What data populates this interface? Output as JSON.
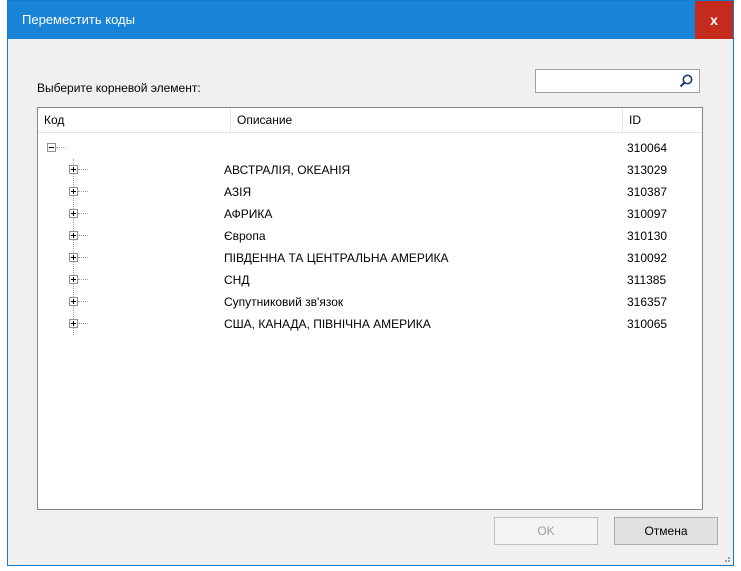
{
  "window": {
    "title": "Переместить коды",
    "close_label": "x"
  },
  "prompt_label": "Выберите корневой элемент:",
  "search": {
    "value": "",
    "placeholder": ""
  },
  "columns": {
    "code": "Код",
    "description": "Описание",
    "id": "ID"
  },
  "root": {
    "description": "",
    "id": "310064",
    "expanded": true
  },
  "rows": [
    {
      "description": "АВСТРАЛІЯ, ОКЕАНІЯ",
      "id": "313029"
    },
    {
      "description": "АЗІЯ",
      "id": "310387"
    },
    {
      "description": "АФРИКА",
      "id": "310097"
    },
    {
      "description": "Європа",
      "id": "310130"
    },
    {
      "description": "ПІВДЕННА ТА ЦЕНТРАЛЬНА АМЕРИКА",
      "id": "310092"
    },
    {
      "description": "СНД",
      "id": "311385"
    },
    {
      "description": "Супутниковий зв'язок",
      "id": "316357"
    },
    {
      "description": "США, КАНАДА, ПІВНІЧНА АМЕРИКА",
      "id": "310065"
    }
  ],
  "buttons": {
    "ok": "OK",
    "cancel": "Отмена"
  },
  "colors": {
    "titlebar": "#1883d7",
    "close": "#c42b1c"
  }
}
